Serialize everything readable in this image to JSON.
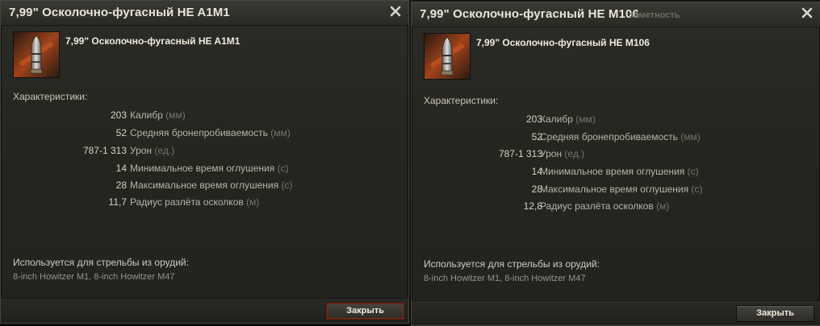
{
  "windows": [
    {
      "title": "7,99\" Осколочно-фугасный HE A1M1",
      "shell_name": "7,99\" Осколочно-фугасный HE A1M1",
      "characteristics_label": "Характеристики:",
      "stats": [
        {
          "value": "203",
          "name": "Калибр",
          "unit": "(мм)"
        },
        {
          "value": "52",
          "name": "Средняя бронепробиваемость",
          "unit": "(мм)"
        },
        {
          "value": "787-1 313",
          "name": "Урон",
          "unit": "(ед.)"
        },
        {
          "value": "14",
          "name": "Минимальное время оглушения",
          "unit": "(с)"
        },
        {
          "value": "28",
          "name": "Максимальное время оглушения",
          "unit": "(с)"
        },
        {
          "value": "11,7",
          "name": "Радиус разлёта осколков",
          "unit": "(м)"
        }
      ],
      "used_label": "Используется для стрельбы из орудий:",
      "guns": "8-inch Howitzer M1, 8-inch Howitzer M47",
      "close_label": "Закрыть"
    },
    {
      "title": "7,99\" Осколочно-фугасный HE M106",
      "ghost_text": "заметность",
      "shell_name": "7,99\" Осколочно-фугасный HE M106",
      "characteristics_label": "Характеристики:",
      "stats": [
        {
          "value": "203",
          "name": "Калибр",
          "unit": "(мм)"
        },
        {
          "value": "52",
          "name": "Средняя бронепробиваемость",
          "unit": "(мм)"
        },
        {
          "value": "787-1 313",
          "name": "Урон",
          "unit": "(ед.)"
        },
        {
          "value": "14",
          "name": "Минимальное время оглушения",
          "unit": "(с)"
        },
        {
          "value": "28",
          "name": "Максимальное время оглушения",
          "unit": "(с)"
        },
        {
          "value": "12,8",
          "name": "Радиус разлёта осколков",
          "unit": "(м)"
        }
      ],
      "used_label": "Используется для стрельбы из орудий:",
      "guns": "8-inch Howitzer M1, 8-inch Howitzer M47",
      "close_label": "Закрыть"
    }
  ],
  "icons": {
    "close": "close-icon",
    "shell": "he-shell-icon"
  },
  "colors": {
    "window_bg": "#262621",
    "title_text": "#e8e5d9",
    "unit_text": "#77746b",
    "button_border_active": "#7a2a1a"
  }
}
